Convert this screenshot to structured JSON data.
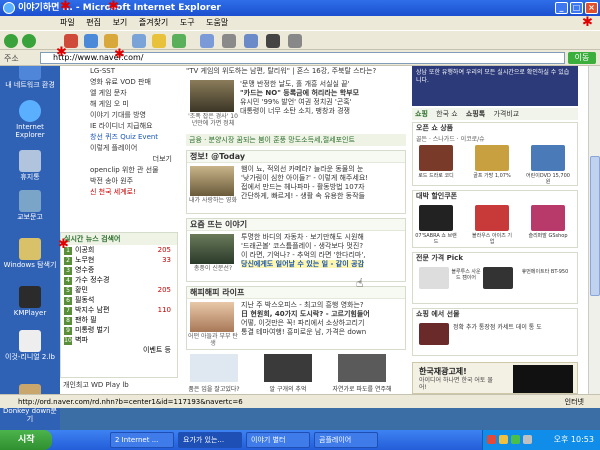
{
  "window": {
    "title": "이야기하면 ... - Microsoft Internet Explorer"
  },
  "menu": [
    "파일",
    "편집",
    "보기",
    "즐겨찾기",
    "도구",
    "도움말"
  ],
  "address": {
    "label": "주소",
    "value": "http://www.naver.com/",
    "go": "이동"
  },
  "desktop_icons": [
    {
      "label": "내 네트워크 환경"
    },
    {
      "label": "Internet Explorer"
    },
    {
      "label": "휴지통"
    },
    {
      "label": "교보문고"
    },
    {
      "label": "Windows 탐색기"
    },
    {
      "label": "KMPlayer"
    },
    {
      "label": "이것-리니얼 2.lb"
    },
    {
      "label": "Donkey down분기"
    }
  ],
  "left_menu": [
    "LG-SST",
    "영화 유료 VOD 판매",
    "엘 게임 문자",
    "해 게임 오 미",
    "이야기 기대를 방영",
    "IE 라이디너 지급해요",
    "창선 퀴즈 Quiz Event",
    "이렇게 플레이어",
    "더보기",
    "openclip 위한 관 선물",
    "박전 송아 원주",
    "신 천국 세계로!"
  ],
  "topnews": "\"TV 게임의 위도하는 남편, 탈리워\" | 혼스 16강, 주북탈 스타는?",
  "news_main": {
    "caption": "'조폭 잡은 경사' 10년만에 가면 정체",
    "lines": [
      "'문맹 반정한 날도, 홀 개흥 서실실 끝'",
      "\"카드는 NO\" 등록금에 허리라는 학부모",
      "유시민 '99% 발언' 여권 정치권 '곤혹'",
      "대통령이 너무 소탄 소치, 팽창과 경쟁"
    ]
  },
  "tabstrip": "금융 · 분양시장 꿈되는 붐이 훈풍    망도소득세,절세포인트",
  "section_today": {
    "title": "정보! @Today",
    "caption": "내가 사랑하는 영화",
    "lines": [
      "햄이 뇨, 적외선 카메라? 늘라운 동물의 눈",
      "'낮가림이 심한 아이들?' - 이렇게 해주세요!",
      "접에서 만드는 헤나파마 - 활동방법 107자",
      "간단하게, 빠르게! - 생활 속 유용한 동작들"
    ]
  },
  "section_story": {
    "title": "요즘 뜨는 이야기",
    "caption": "총풍이 신분선?",
    "lines": [
      "투명한 바디의 자동차 · 보기만해도 시원해",
      "'드래곤볼' 코스튬플레이 - 생각보다 멋진?",
      "이 라면, 기억나? - 추억의 라면 '한다리마',",
      "당신에게도 일어날 수 있는 일 - 같이 공감"
    ]
  },
  "section_life": {
    "title": "해피해피 라이프",
    "caption": "어떤 아들과 부부 탄생",
    "lines": [
      "지난 주 박스오피스 - 최고의 흥행 영화는?",
      "日 현원회, 40가지 도시락? - 고르기힘들어",
      "어떻, 이것만은 꼭! 파리에서 소상하고리기",
      "통결 테마여행! 흥미로운 남, 가격은 down"
    ]
  },
  "thumbs": [
    {
      "caption": "품은 입을 잘고있다?"
    },
    {
      "caption": "알 구개의 추억"
    },
    {
      "caption": "자연가로 파도를 연주해"
    }
  ],
  "keywords": {
    "title": "실시간 뉴스 검색어",
    "items": [
      {
        "rank": "1",
        "label": "이공희",
        "count": "205"
      },
      {
        "rank": "2",
        "label": "노무현",
        "count": "33"
      },
      {
        "rank": "3",
        "label": "영수증",
        "count": ""
      },
      {
        "rank": "4",
        "label": "가수 정수경",
        "count": ""
      },
      {
        "rank": "5",
        "label": "황민",
        "count": "205"
      },
      {
        "rank": "6",
        "label": "필동석",
        "count": ""
      },
      {
        "rank": "7",
        "label": "박지수 남편",
        "count": "110"
      },
      {
        "rank": "8",
        "label": "팬하 필",
        "count": ""
      },
      {
        "rank": "9",
        "label": "미통령 벌기",
        "count": ""
      },
      {
        "rank": "10",
        "label": "벽파",
        "count": ""
      }
    ],
    "more": "이벤트 등"
  },
  "left_footer": "개인최고 WD Play lb",
  "right_ad": "상남 또한 유행하여 우리의 모든 실시간으로 확인하실 수 있습니다.",
  "shop_tabs": [
    "쇼핑",
    "한국 쇼",
    "쇼핑톡",
    "가격비교"
  ],
  "shop_best": {
    "title": "오픈 쇼 상품",
    "subtitle": "골든 · 스나가드 · 이코로/슈",
    "products": [
      {
        "caption": "로드 드라로 코디"
      },
      {
        "caption": "골프 가방 1,07%"
      },
      {
        "caption": "어린이DVD 15,700원"
      }
    ]
  },
  "shop_deal": {
    "title": "대박 할인쿠폰",
    "products": [
      {
        "caption": "07'SABRA 쇼 브랜드"
      },
      {
        "caption": "블라우스 아이즈 기업"
      },
      {
        "caption": "슬리퍼발 GSshop"
      }
    ]
  },
  "shop_electronics": {
    "title": "전문 가격 Pick",
    "items": [
      "블루투스 사운드 캠이어",
      "휴먼메이트타 BT-950"
    ]
  },
  "shop_wallet": {
    "title": "쇼핑 에서 선물",
    "items": [
      "정확 추가 통장점 카세트 데이 통 도"
    ]
  },
  "banner": {
    "title": "한국재광고제!",
    "sub": "아이디어 하나면 한국 어토 물어!"
  },
  "status": {
    "url": "http://ord.naver.com/rd.nhn?b=center1&id=117193&navertc=6",
    "zone": "인터넷"
  },
  "taskbar": {
    "start": "시작",
    "tasks": [
      "2 Internet ...",
      "요가가 있는...",
      "이야기 별터",
      "곰플레이어"
    ],
    "clock": "오후 10:53"
  },
  "colors": {
    "accent": "#2a6d2a",
    "title_blue": "#1b4fcf",
    "highlight": "#fff7b0"
  }
}
